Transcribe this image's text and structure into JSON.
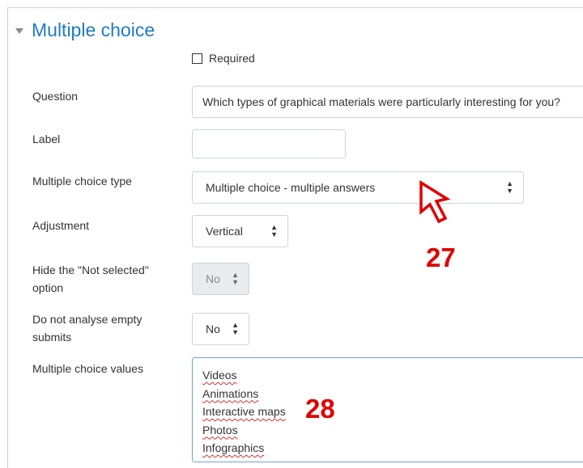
{
  "section": {
    "title": "Multiple choice"
  },
  "required": {
    "label": "Required",
    "checked": false
  },
  "fields": {
    "question": {
      "label": "Question",
      "value": "Which types of graphical materials were particularly interesting for you?"
    },
    "label": {
      "label": "Label",
      "value": ""
    },
    "mc_type": {
      "label": "Multiple choice type",
      "value": "Multiple choice - multiple answers"
    },
    "adjustment": {
      "label": "Adjustment",
      "value": "Vertical"
    },
    "hide_not_selected": {
      "label_line1": "Hide the \"Not selected\"",
      "label_line2": "option",
      "value": "No"
    },
    "no_analyse_empty": {
      "label_line1": "Do not analyse empty",
      "label_line2": "submits",
      "value": "No"
    },
    "mc_values": {
      "label": "Multiple choice values",
      "lines": [
        "Videos",
        "Animations",
        "Interactive maps",
        "Photos",
        "Infographics"
      ]
    }
  },
  "annotations": {
    "a27": "27",
    "a28": "28"
  },
  "colors": {
    "title": "#1f7ac7",
    "annotation": "#e00000",
    "textarea_border": "#6ea4d8"
  },
  "icons": {
    "collapse": "caret-down-icon",
    "select": "up-down-arrows-icon",
    "pointer": "cursor-arrow-icon"
  }
}
